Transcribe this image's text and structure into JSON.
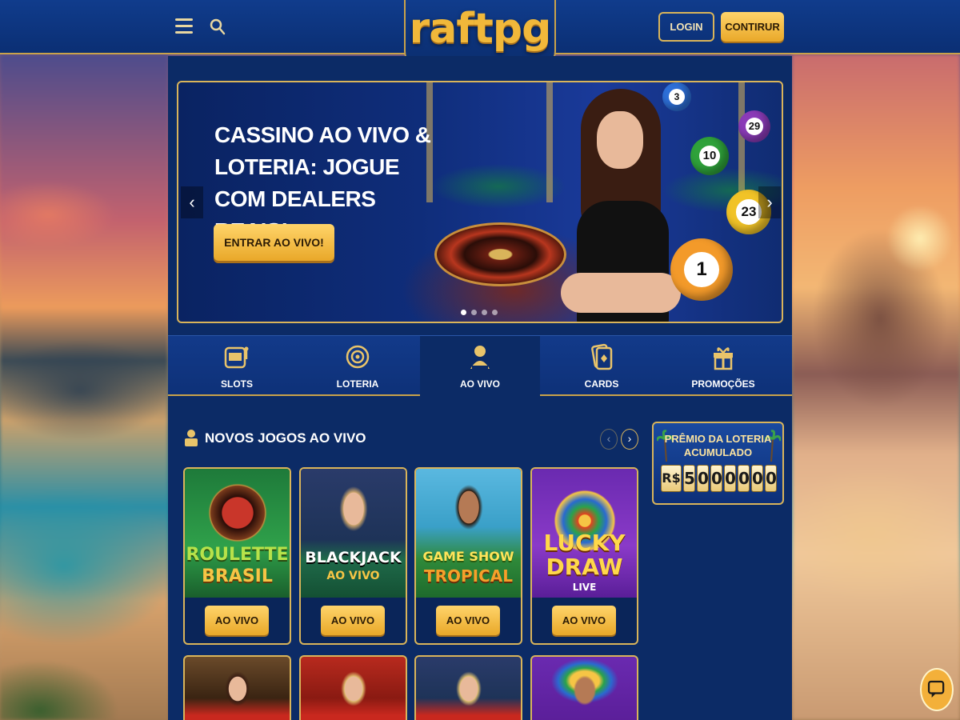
{
  "header": {
    "logo": "raftpg",
    "login_label": "LOGIN",
    "signup_label": "CONTIRUR"
  },
  "hero": {
    "title": "CASSINO AO VIVO & LOTERIA: JOGUE COM DEALERS REAIS!",
    "cta_label": "ENTRAR AO VIVO!",
    "balls": [
      "3",
      "29",
      "10",
      "23",
      "1"
    ],
    "slides": 4,
    "active_slide": 1
  },
  "categories": [
    {
      "label": "SLOTS",
      "icon": "slots-icon"
    },
    {
      "label": "LOTERIA",
      "icon": "lottery-icon"
    },
    {
      "label": "AO VIVO",
      "icon": "live-dealer-icon",
      "active": true
    },
    {
      "label": "CARDS",
      "icon": "cards-icon"
    },
    {
      "label": "PROMOÇÕES",
      "icon": "gift-icon"
    }
  ],
  "section": {
    "title": "NOVOS JOGOS AO VIVO"
  },
  "games": [
    {
      "title_line1": "ROULETTE",
      "title_line2": "BRASIL",
      "button": "AO VIVO"
    },
    {
      "title_line1": "BLACKJACK",
      "title_line2": "AO VIVO",
      "button": "AO VIVO"
    },
    {
      "title_line1": "GAME SHOW",
      "title_line2": "TROPICAL",
      "button": "AO VIVO"
    },
    {
      "title_line1": "LUCKY",
      "title_line2": "DRAW",
      "title_line3": "LIVE",
      "button": "AO VIVO"
    }
  ],
  "jackpot": {
    "title": "PRÊMIO DA LOTERIA ACUMULADO",
    "currency": "R$",
    "digits": [
      "5",
      "0",
      "0",
      "0",
      "0",
      "0",
      "0"
    ]
  },
  "colors": {
    "navy": "#0c2b66",
    "gold": "#d9b45a",
    "button_gold": "#f3b83a"
  }
}
